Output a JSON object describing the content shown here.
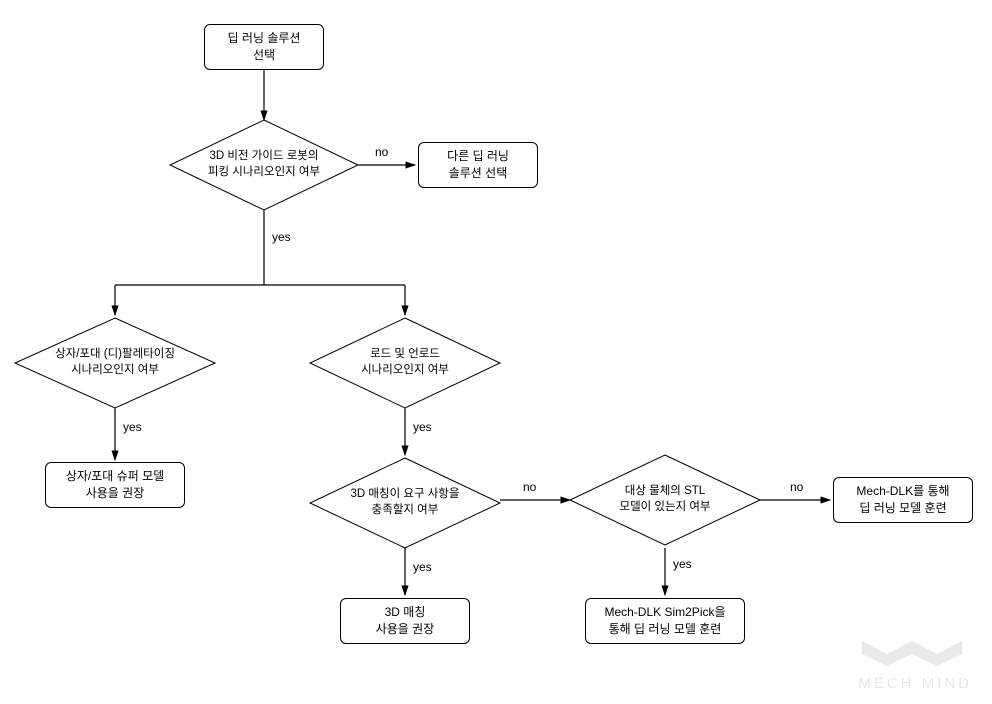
{
  "chart_data": {
    "type": "flowchart",
    "title": "",
    "nodes": [
      {
        "id": "n1",
        "shape": "process",
        "text": "딥 러닝 솔루션\n선택"
      },
      {
        "id": "d1",
        "shape": "decision",
        "text": "3D 비전 가이드 로봇의\n피킹 시나리오인지 여부"
      },
      {
        "id": "n2",
        "shape": "process",
        "text": "다른 딥 러닝\n솔루션 선택"
      },
      {
        "id": "d2",
        "shape": "decision",
        "text": "상자/포대 (디)팔레타이징\n시나리오인지 여부"
      },
      {
        "id": "d3",
        "shape": "decision",
        "text": "로드 및 언로드\n시나리오인지 여부"
      },
      {
        "id": "n3",
        "shape": "process",
        "text": "상자/포대 슈퍼 모델\n사용을 권장"
      },
      {
        "id": "d4",
        "shape": "decision",
        "text": "3D 매칭이 요구 사항을\n충족할지 여부"
      },
      {
        "id": "d5",
        "shape": "decision",
        "text": "대상 물체의 STL\n모델이 있는지 여부"
      },
      {
        "id": "n4",
        "shape": "process",
        "text": "3D 매칭\n사용을 권장"
      },
      {
        "id": "n5",
        "shape": "process",
        "text": "Mech-DLK Sim2Pick을\n통해 딥 러닝 모델 훈련"
      },
      {
        "id": "n6",
        "shape": "process",
        "text": "Mech-DLK를 통해\n딥 러닝 모델 훈련"
      }
    ],
    "edges": [
      {
        "from": "n1",
        "to": "d1",
        "label": ""
      },
      {
        "from": "d1",
        "to": "n2",
        "label": "no"
      },
      {
        "from": "d1",
        "to": "branch",
        "label": "yes"
      },
      {
        "from": "branch",
        "to": "d2",
        "label": ""
      },
      {
        "from": "branch",
        "to": "d3",
        "label": ""
      },
      {
        "from": "d2",
        "to": "n3",
        "label": "yes"
      },
      {
        "from": "d3",
        "to": "d4",
        "label": "yes"
      },
      {
        "from": "d4",
        "to": "n4",
        "label": "yes"
      },
      {
        "from": "d4",
        "to": "d5",
        "label": "no"
      },
      {
        "from": "d5",
        "to": "n5",
        "label": "yes"
      },
      {
        "from": "d5",
        "to": "n6",
        "label": "no"
      }
    ]
  },
  "labels": {
    "yes": "yes",
    "no": "no"
  },
  "watermark": {
    "text": "MECH MIND"
  }
}
